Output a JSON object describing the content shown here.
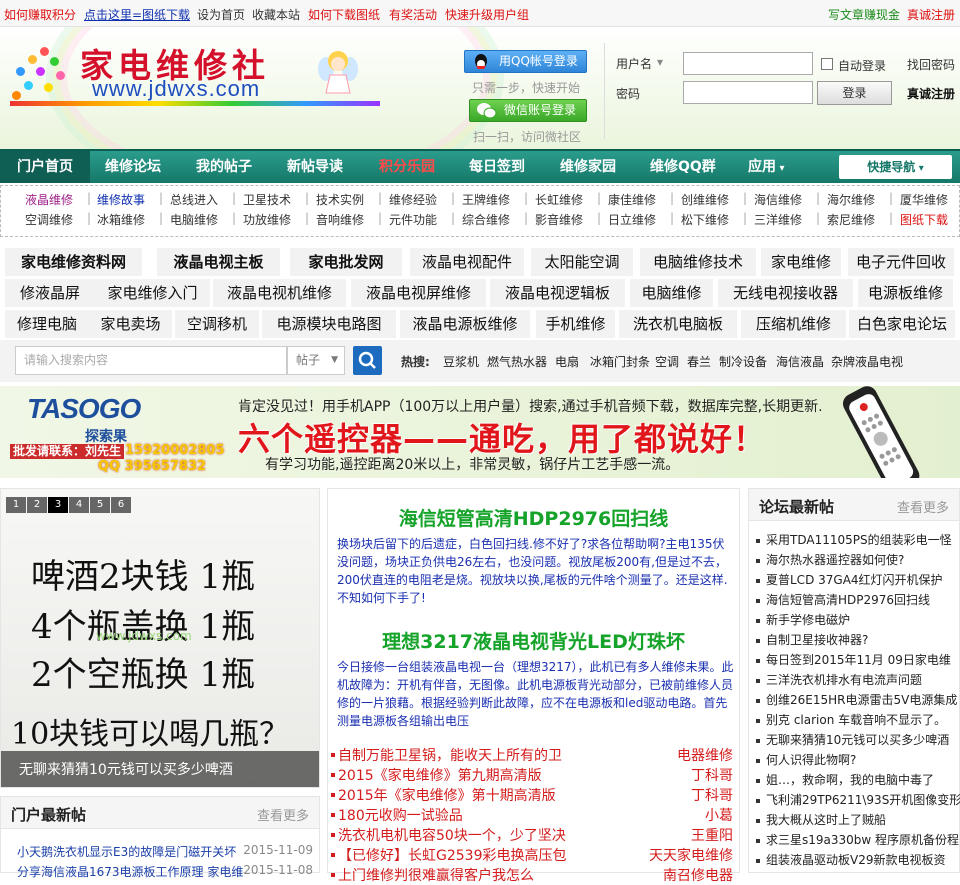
{
  "topbar": {
    "left": [
      {
        "label": "如何赚取积分",
        "color": "#d11"
      },
      {
        "label": "点击这里=图纸下载",
        "color": "#1030b0",
        "underline": true
      },
      {
        "label": "设为首页",
        "color": "#333"
      },
      {
        "label": "收藏本站",
        "color": "#333"
      },
      {
        "label": "如何下载图纸",
        "color": "#d11"
      },
      {
        "label": "有奖活动",
        "color": "#d11"
      },
      {
        "label": "快速升级用户组",
        "color": "#d11"
      }
    ],
    "right": [
      {
        "label": "写文章赚现金",
        "color": "#1a8a1a"
      },
      {
        "label": "真诚注册",
        "color": "#d11"
      }
    ]
  },
  "header": {
    "site_name": "家电维修社",
    "site_url": "www.jdwxs.com",
    "qq_login": "用QQ帐号登录",
    "qq_hint": "只需一步，快速开始",
    "wechat_login": "微信账号登录",
    "wechat_hint": "扫一扫，访问微社区",
    "username_label": "用户名",
    "password_label": "密码",
    "auto_login": "自动登录",
    "find_password": "找回密码",
    "login_button": "登录",
    "register": "真诚注册"
  },
  "nav": {
    "items": [
      "门户首页",
      "维修论坛",
      "我的帖子",
      "新帖导读",
      "积分乐园",
      "每日签到",
      "维修家园",
      "维修QQ群",
      "应用"
    ],
    "quick_nav": "快捷导航"
  },
  "subnav": {
    "row1": [
      "液晶维修",
      "维修故事",
      "总线进入",
      "卫星技术",
      "技术实例",
      "维修经验",
      "王牌维修",
      "长虹维修",
      "康佳维修",
      "创维维修",
      "海信维修",
      "海尔维修",
      "厦华维修"
    ],
    "row2": [
      "空调维修",
      "冰箱维修",
      "电脑维修",
      "功放维修",
      "音响维修",
      "元件功能",
      "综合维修",
      "影音维修",
      "日立维修",
      "松下维修",
      "三洋维修",
      "索尼维修",
      "图纸下载"
    ]
  },
  "tags": {
    "row1": [
      "家电维修资料网",
      "液晶电视主板",
      "家电批发网",
      "液晶电视配件",
      "太阳能空调",
      "电脑维修技术",
      "家电维修",
      "电子元件回收"
    ],
    "row2": [
      "修液晶屏",
      "家电维修入门",
      "液晶电视机维修",
      "液晶电视屏维修",
      "液晶电视逻辑板",
      "电脑维修",
      "无线电视接收器",
      "电源板维修"
    ],
    "row3": [
      "修理电脑",
      "家电卖场",
      "空调移机",
      "电源模块电路图",
      "液晶电源板维修",
      "手机维修",
      "洗衣机电脑板",
      "压缩机维修",
      "白色家电论坛"
    ]
  },
  "search": {
    "placeholder": "请输入搜索内容",
    "scope": "帖子",
    "hot_label": "热搜:",
    "hot": [
      "豆浆机",
      "燃气热水器",
      "电扇",
      "冰箱门封条",
      "空调",
      "春兰",
      "制冷设备",
      "海信液晶",
      "杂牌液晶电视"
    ]
  },
  "ad": {
    "brand": "TASOGO",
    "brand_cn": "探索果",
    "contact_label": "批发请联系：",
    "contact_name": "刘先生",
    "phone": "15920002805",
    "qq": "QQ 395657832",
    "line1": "肯定没见过！用手机APP（100万以上用户量）搜索,通过手机音频下载，数据库完整,长期更新.",
    "headline": "六个遥控器——通吃，用了都说好！",
    "line3": "有学习功能,遥控距离20米以上，非常灵敏，锅仔片工艺手感一流。"
  },
  "slider": {
    "pages": [
      "1",
      "2",
      "3",
      "4",
      "5",
      "6"
    ],
    "current": "3",
    "hand_lines": [
      "啤酒2块钱 1瓶",
      "4个瓶盖换 1瓶",
      "2个空瓶换 1瓶",
      "10块钱可以喝几瓶？"
    ],
    "watermark": "www.jdwxs.com",
    "caption": "无聊来猜猜10元钱可以买多少啤酒"
  },
  "portal": {
    "title": "门户最新帖",
    "more": "查看更多",
    "items": [
      {
        "title": "小天鹅洗衣机显示E3的故障是门磁开关坏",
        "date": "2015-11-09"
      },
      {
        "title": "分享海信液晶1673电源板工作原理 家电维",
        "date": "2015-11-08"
      }
    ]
  },
  "center": {
    "article1_title": "海信短管高清HDP2976回扫线",
    "article1_body": "换场块后留下的后遗症，白色回扫线.修不好了?求各位帮助啊?主电135伏没问题，场块正负供电26左右，也没问题。视放尾板200有,但是过不去，200伏直连的电阻老是烧。视放块以换,尾板的元件啥个测量了。还是这样.不知如何下手了!",
    "article2_title": "理想3217液晶电视背光LED灯珠坏",
    "article2_body": "今日接修一台组装液晶电视一台（理想3217），此机已有多人维修未果。此机故障为：开机有伴音，无图像。此机电源板背光动部分，已被前维修人员修的一片狼藉。根据经验判断此故障，应不在电源板和led驱动电路。首先测量电源板各组输出电压",
    "list": [
      {
        "title": "自制万能卫星锅，能收天上所有的卫",
        "category": "电器维修"
      },
      {
        "title": "2015《家电维修》第九期高清版",
        "category": "丁科哥"
      },
      {
        "title": "2015年《家电维修》第十期高清版",
        "category": "丁科哥"
      },
      {
        "title": "180元收购一试验品",
        "category": "小葛"
      },
      {
        "title": "洗衣机电机电容50块一个，少了坚决",
        "category": "王重阳"
      },
      {
        "title": "【已修好】长虹G2539彩电换高压包",
        "category": "天天家电维修"
      },
      {
        "title": "上门维修判很难赢得客户我怎么",
        "category": "南召修电器"
      }
    ]
  },
  "forum": {
    "title": "论坛最新帖",
    "more": "查看更多",
    "items": [
      "采用TDA11105PS的组装彩电一怪",
      "海尔热水器遥控器如何使?",
      "夏普LCD 37GA4红灯闪开机保护",
      "海信短管高清HDP2976回扫线",
      "新手学修电磁炉",
      "自制卫星接收神器?",
      "每日签到2015年11月 09日家电维",
      "三洋洗衣机排水有电流声问题",
      "创维26E15HR电源雷击5V电源集成",
      "别克 clarion 车载音响不显示了。",
      "无聊来猜猜10元钱可以买多少啤酒",
      "何人识得此物啊?",
      "姐…，救命啊，我的电脑中毒了",
      "飞利浦29TP6211\\93S开机图像变形",
      "我大概从这时上了贼船",
      "求三星s19a330bw 程序原机备份程",
      "组装液晶驱动板V29新款电视板资"
    ]
  },
  "colors": {
    "nav_bg": "#157868",
    "link_red": "#d11",
    "link_blue": "#1030b0",
    "title_green": "#16a32a"
  }
}
